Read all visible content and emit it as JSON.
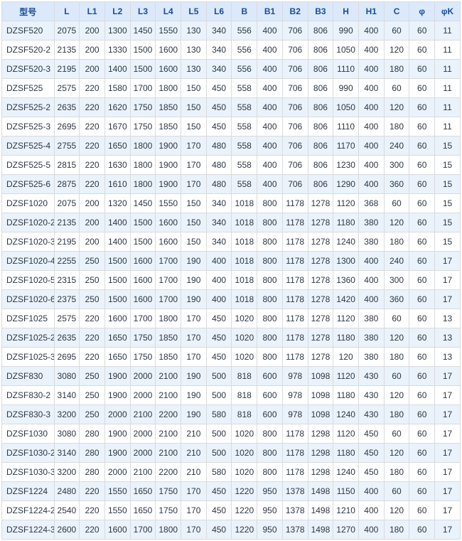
{
  "chart_data": {
    "type": "table",
    "headers": [
      "型号",
      "L",
      "L1",
      "L2",
      "L3",
      "L4",
      "L5",
      "L6",
      "B",
      "B1",
      "B2",
      "B3",
      "H",
      "H1",
      "C",
      "φ",
      "φK"
    ],
    "rows": [
      [
        "DZSF520",
        2075,
        200,
        1300,
        1450,
        1550,
        130,
        340,
        556,
        400,
        706,
        806,
        990,
        400,
        60,
        60,
        11
      ],
      [
        "DZSF520-2",
        2135,
        200,
        1330,
        1500,
        1600,
        130,
        340,
        556,
        400,
        706,
        806,
        1050,
        400,
        120,
        60,
        11
      ],
      [
        "DZSF520-3",
        2195,
        200,
        1400,
        1500,
        1600,
        130,
        340,
        556,
        400,
        706,
        806,
        1110,
        400,
        180,
        60,
        11
      ],
      [
        "DZSF525",
        2575,
        220,
        1580,
        1700,
        1800,
        150,
        450,
        558,
        400,
        706,
        806,
        990,
        400,
        60,
        60,
        11
      ],
      [
        "DZSF525-2",
        2635,
        220,
        1620,
        1750,
        1850,
        150,
        450,
        558,
        400,
        706,
        806,
        1050,
        400,
        120,
        60,
        11
      ],
      [
        "DZSF525-3",
        2695,
        220,
        1670,
        1750,
        1850,
        150,
        450,
        558,
        400,
        706,
        806,
        1110,
        400,
        180,
        60,
        11
      ],
      [
        "DZSF525-4",
        2755,
        220,
        1650,
        1800,
        1900,
        170,
        480,
        558,
        400,
        706,
        806,
        1170,
        400,
        240,
        60,
        15
      ],
      [
        "DZSF525-5",
        2815,
        220,
        1630,
        1800,
        1900,
        170,
        480,
        558,
        400,
        706,
        806,
        1230,
        400,
        300,
        60,
        15
      ],
      [
        "DZSF525-6",
        2875,
        220,
        1610,
        1800,
        1900,
        170,
        480,
        558,
        400,
        706,
        806,
        1290,
        400,
        360,
        60,
        15
      ],
      [
        "DZSF1020",
        2075,
        200,
        1320,
        1450,
        1550,
        150,
        340,
        1018,
        800,
        1178,
        1278,
        1120,
        368,
        60,
        60,
        15
      ],
      [
        "DZSF1020-2",
        2135,
        200,
        1400,
        1500,
        1600,
        150,
        340,
        1018,
        800,
        1178,
        1278,
        1180,
        380,
        120,
        60,
        15
      ],
      [
        "DZSF1020-3",
        2195,
        200,
        1400,
        1500,
        1600,
        150,
        340,
        1018,
        800,
        1178,
        1278,
        1240,
        380,
        180,
        60,
        15
      ],
      [
        "DZSF1020-4",
        2255,
        250,
        1500,
        1600,
        1700,
        190,
        400,
        1018,
        800,
        1178,
        1278,
        1300,
        400,
        240,
        60,
        17
      ],
      [
        "DZSF1020-5",
        2315,
        250,
        1500,
        1600,
        1700,
        190,
        400,
        1018,
        800,
        1178,
        1278,
        1360,
        400,
        300,
        60,
        17
      ],
      [
        "DZSF1020-6",
        2375,
        250,
        1500,
        1600,
        1700,
        190,
        400,
        1018,
        800,
        1178,
        1278,
        1420,
        400,
        360,
        60,
        17
      ],
      [
        "DZSF1025",
        2575,
        220,
        1600,
        1700,
        1800,
        170,
        450,
        1020,
        800,
        1178,
        1278,
        1120,
        380,
        60,
        60,
        13
      ],
      [
        "DZSF1025-2",
        2635,
        220,
        1650,
        1750,
        1850,
        170,
        450,
        1020,
        800,
        1178,
        1278,
        1180,
        380,
        120,
        60,
        13
      ],
      [
        "DZSF1025-3",
        2695,
        220,
        1650,
        1750,
        1850,
        170,
        450,
        1020,
        800,
        1178,
        1278,
        120,
        380,
        180,
        60,
        13
      ],
      [
        "DZSF830",
        3080,
        250,
        1900,
        2000,
        2100,
        190,
        500,
        818,
        600,
        978,
        1098,
        1120,
        430,
        60,
        60,
        17
      ],
      [
        "DZSF830-2",
        3140,
        250,
        1900,
        2000,
        2100,
        190,
        500,
        818,
        600,
        978,
        1098,
        1180,
        430,
        120,
        60,
        17
      ],
      [
        "DZSF830-3",
        3200,
        250,
        2000,
        2100,
        2200,
        190,
        580,
        818,
        600,
        978,
        1098,
        1240,
        430,
        180,
        60,
        17
      ],
      [
        "DZSF1030",
        3080,
        280,
        1900,
        2000,
        2100,
        210,
        500,
        1020,
        800,
        1178,
        1298,
        1120,
        450,
        60,
        60,
        17
      ],
      [
        "DZSF1030-2",
        3140,
        280,
        1900,
        2000,
        2100,
        210,
        500,
        1020,
        800,
        1178,
        1298,
        1180,
        450,
        120,
        60,
        17
      ],
      [
        "DZSF1030-3",
        3200,
        280,
        2000,
        2100,
        2200,
        210,
        580,
        1020,
        800,
        1178,
        1298,
        1240,
        450,
        180,
        60,
        17
      ],
      [
        "DZSF1224",
        2480,
        220,
        1550,
        1650,
        1750,
        170,
        450,
        1220,
        950,
        1378,
        1498,
        1150,
        400,
        60,
        60,
        17
      ],
      [
        "DZSF1224-2",
        2540,
        220,
        1550,
        1650,
        1750,
        170,
        450,
        1220,
        950,
        1378,
        1498,
        1210,
        400,
        120,
        60,
        17
      ],
      [
        "DZSF1224-3",
        2600,
        220,
        1600,
        1700,
        1800,
        170,
        450,
        1220,
        950,
        1378,
        1498,
        1270,
        400,
        180,
        60,
        17
      ]
    ]
  }
}
